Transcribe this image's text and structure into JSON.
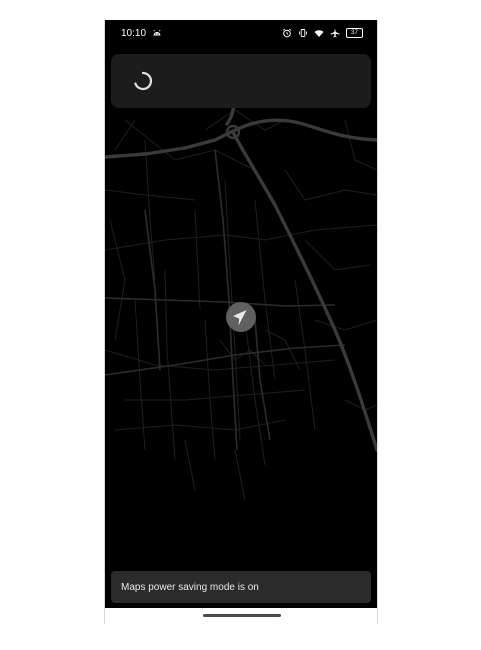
{
  "status_bar": {
    "time": "10:10",
    "left_icons": [
      "android-icon"
    ],
    "right_icons": [
      "alarm-icon",
      "vibrate-icon",
      "wifi-icon",
      "airplane-icon"
    ],
    "battery": "37"
  },
  "snackbar": {
    "message": "Maps power saving mode is on"
  },
  "colors": {
    "map_background": "#000000",
    "road_major": "#3a3a3a",
    "road_minor": "#222222",
    "card": "#1c1c1c",
    "snackbar": "#2b2b2b",
    "location_marker": "#606060"
  }
}
